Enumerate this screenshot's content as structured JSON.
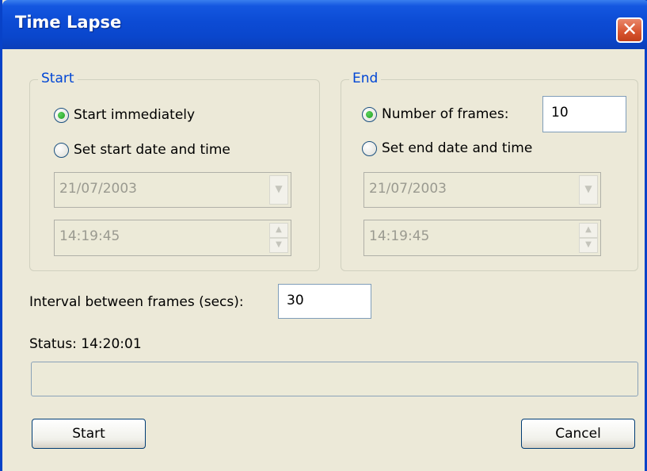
{
  "window": {
    "title": "Time Lapse",
    "close_symbol": "✕"
  },
  "start_group": {
    "legend": "Start",
    "option_immediately": "Start immediately",
    "option_datetime": "Set start date and time",
    "date_value": "21/07/2003",
    "time_value": "14:19:45",
    "selected": "immediately"
  },
  "end_group": {
    "legend": "End",
    "option_frames": "Number of frames:",
    "frames_value": "10",
    "option_datetime": "Set end date and time",
    "date_value": "21/07/2003",
    "time_value": "14:19:45",
    "selected": "frames"
  },
  "interval": {
    "label": "Interval between frames (secs):",
    "value": "30"
  },
  "status": {
    "text": "Status: 14:20:01"
  },
  "progress": {
    "fraction": 0
  },
  "buttons": {
    "start": "Start",
    "cancel": "Cancel"
  },
  "icons": {
    "dropdown": "chevron-down-icon",
    "spin_up": "arrow-up-icon",
    "spin_down": "arrow-down-icon"
  },
  "colors": {
    "titlebar": "#0a46cc",
    "window_bg": "#ece9d8",
    "legend": "#0046d5",
    "radio_dot": "#21a121",
    "close": "#d7532e"
  }
}
